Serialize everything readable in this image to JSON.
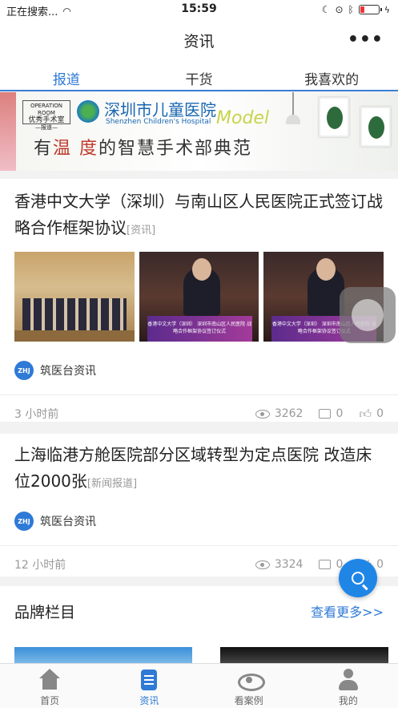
{
  "status_bar": {
    "carrier": "正在搜索...",
    "time": "15:59"
  },
  "nav": {
    "title": "资讯",
    "more_icon": "more-dots-icon"
  },
  "tabs": [
    {
      "label": "报道",
      "active": true
    },
    {
      "label": "干货",
      "active": false
    },
    {
      "label": "我喜欢的",
      "active": false
    }
  ],
  "banner": {
    "stamp_line1": "OPERATION ROOM",
    "stamp_line2": "优秀手术室",
    "stamp_line3": "—报道—",
    "hospital_cn": "深圳市儿童医院",
    "hospital_en": "Shenzhen Children's Hospital",
    "model_word": "Model",
    "slogan_pre": "有",
    "slogan_hl1": "温",
    "slogan_mid": " ",
    "slogan_hl2": "度",
    "slogan_post": "的智慧手术部典范"
  },
  "articles": [
    {
      "headline": "香港中文大学（深圳）与南山区人民医院正式签订战略合作框架协议",
      "tag": "[资讯]",
      "image_caption": "香港中文大学（深圳） 深圳市南山区人民医院 战略合作框架协议签订仪式",
      "source": "筑医台资讯",
      "source_badge": "ZHJ",
      "time": "3 小时前",
      "views": "3262",
      "comments": "0",
      "likes": "0"
    },
    {
      "headline": "上海临港方舱医院部分区域转型为定点医院 改造床位2000张",
      "tag": "[新闻报道]",
      "source": "筑医台资讯",
      "source_badge": "ZHJ",
      "time": "12 小时前",
      "views": "3324",
      "comments": "0",
      "likes": "0"
    }
  ],
  "brand_section": {
    "title": "品牌栏目",
    "more": "查看更多>>"
  },
  "tabbar": [
    {
      "label": "首页",
      "icon": "home-icon",
      "active": false
    },
    {
      "label": "资讯",
      "icon": "news-icon",
      "active": true
    },
    {
      "label": "看案例",
      "icon": "eye-icon",
      "active": false
    },
    {
      "label": "我的",
      "icon": "user-icon",
      "active": false
    }
  ],
  "colors": {
    "accent": "#2f7ad6",
    "fab": "#1f86e6",
    "battery_low": "#e33333"
  }
}
